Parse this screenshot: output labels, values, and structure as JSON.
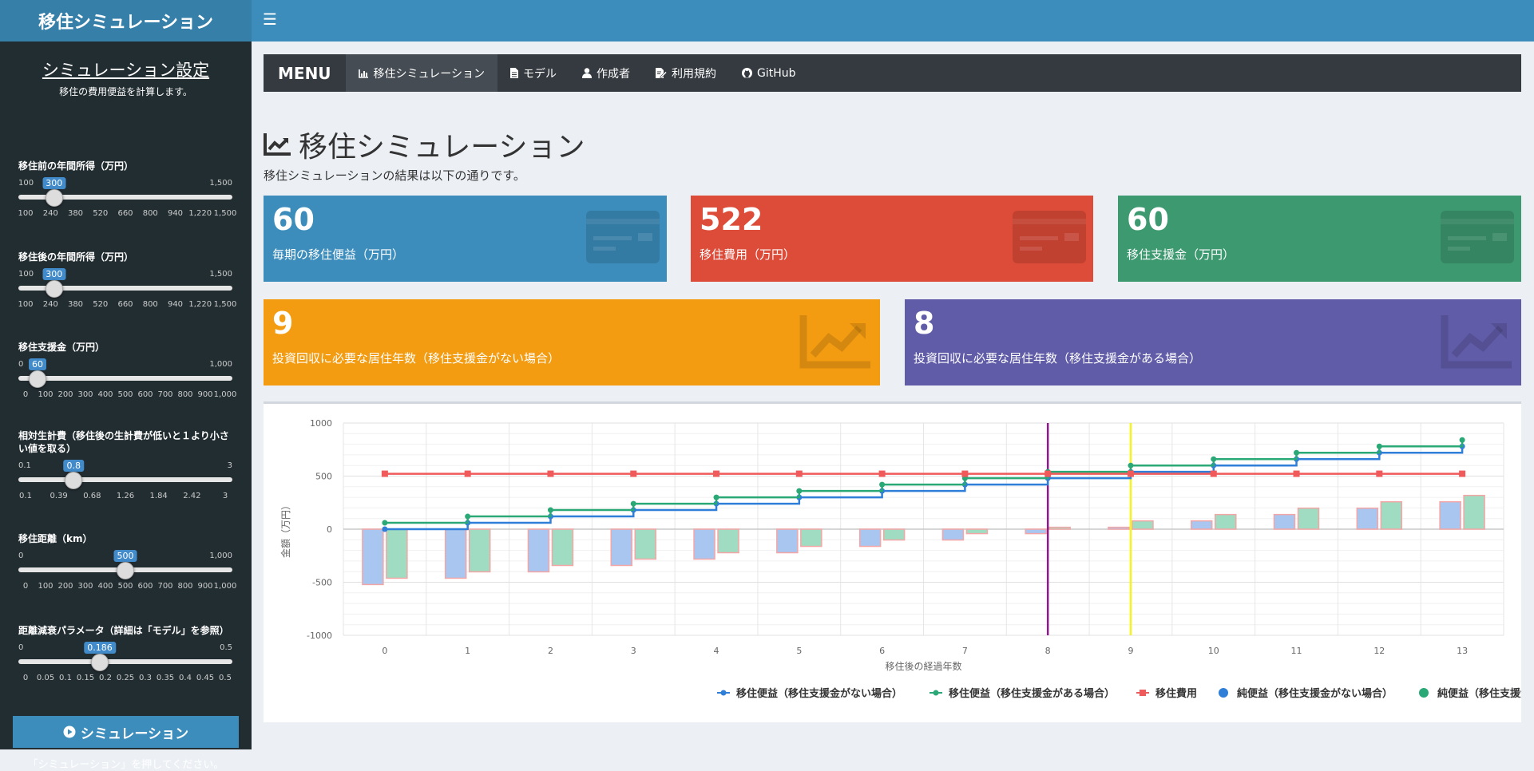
{
  "app": {
    "title": "移住シミュレーション",
    "toggle_icon": "menu-icon"
  },
  "sidebar": {
    "title": "シミュレーション設定",
    "subtitle": "移住の費用便益を計算します。",
    "sliders": [
      {
        "label": "移住前の年間所得（万円）",
        "min_label": "100",
        "max_label": "1,500",
        "value_label": "300",
        "value_fraction": 0.143,
        "ticks": [
          "100",
          "240",
          "380",
          "520",
          "660",
          "800",
          "940",
          "1,220",
          "1,500"
        ]
      },
      {
        "label": "移住後の年間所得（万円）",
        "min_label": "100",
        "max_label": "1,500",
        "value_label": "300",
        "value_fraction": 0.143,
        "ticks": [
          "100",
          "240",
          "380",
          "520",
          "660",
          "800",
          "940",
          "1,220",
          "1,500"
        ]
      },
      {
        "label": "移住支援金（万円）",
        "min_label": "0",
        "max_label": "1,000",
        "value_label": "60",
        "value_fraction": 0.06,
        "ticks": [
          "0",
          "100",
          "200",
          "300",
          "400",
          "500",
          "600",
          "700",
          "800",
          "900",
          "1,000"
        ]
      },
      {
        "label": "相対生計費（移住後の生計費が低いと１より小さい値を取る）",
        "min_label": "0.1",
        "max_label": "3",
        "value_label": "0.8",
        "value_fraction": 0.241,
        "ticks": [
          "0.1",
          "0.39",
          "0.68",
          "1.26",
          "1.84",
          "2.42",
          "3"
        ]
      },
      {
        "label": "移住距離（km）",
        "min_label": "0",
        "max_label": "1,000",
        "value_label": "500",
        "value_fraction": 0.5,
        "ticks": [
          "0",
          "100",
          "200",
          "300",
          "400",
          "500",
          "600",
          "700",
          "800",
          "900",
          "1,000"
        ]
      },
      {
        "label": "距離減衰パラメータ（詳細は「モデル」を参照）",
        "min_label": "0",
        "max_label": "0.5",
        "value_label": "0.186",
        "value_fraction": 0.372,
        "ticks": [
          "0",
          "0.05",
          "0.1",
          "0.15",
          "0.2",
          "0.25",
          "0.3",
          "0.35",
          "0.4",
          "0.45",
          "0.5"
        ]
      }
    ],
    "button_label": "シミュレーション",
    "button_icon": "play-circle-icon",
    "note": "「シミュレーション」を押してください。"
  },
  "menu": {
    "brand": "MENU",
    "items": [
      {
        "label": "移住シミュレーション",
        "icon": "bar-chart-icon",
        "active": true
      },
      {
        "label": "モデル",
        "icon": "file-icon",
        "active": false
      },
      {
        "label": "作成者",
        "icon": "user-icon",
        "active": false
      },
      {
        "label": "利用規約",
        "icon": "edit-document-icon",
        "active": false
      },
      {
        "label": "GitHub",
        "icon": "github-icon",
        "active": false
      }
    ]
  },
  "page": {
    "title": "移住シミュレーション",
    "title_icon": "line-chart-icon",
    "subtitle": "移住シミュレーションの結果は以下の通りです。"
  },
  "value_boxes": [
    {
      "value": "60",
      "label": "毎期の移住便益（万円）",
      "color": "#3c8dbc",
      "icon": "credit-card-icon"
    },
    {
      "value": "522",
      "label": "移住費用（万円）",
      "color": "#dd4b39",
      "icon": "credit-card-icon"
    },
    {
      "value": "60",
      "label": "移住支援金（万円）",
      "color": "#3d9970",
      "icon": "credit-card-icon"
    },
    {
      "value": "9",
      "label": "投資回収に必要な居住年数（移住支援金がない場合）",
      "color": "#f39c12",
      "icon": "chart-line-icon"
    },
    {
      "value": "8",
      "label": "投資回収に必要な居住年数（移住支援金がある場合）",
      "color": "#605ca8",
      "icon": "chart-line-icon"
    }
  ],
  "chart_data": {
    "type": "line",
    "xlabel": "移住後の経過年数",
    "ylabel": "金額（万円）",
    "x": [
      0,
      1,
      2,
      3,
      4,
      5,
      6,
      7,
      8,
      9,
      10,
      11,
      12,
      13
    ],
    "ylim": [
      -1000,
      1000
    ],
    "yticks": [
      "1000",
      "500",
      "0",
      "-500",
      "-1000"
    ],
    "grid": true,
    "legend_position": "bottom",
    "series": [
      {
        "name": "移住便益（移住支援金がない場合）",
        "type": "step-line",
        "color": "#2f7ed8",
        "values": [
          0,
          60,
          120,
          180,
          240,
          300,
          360,
          420,
          480,
          540,
          600,
          660,
          720,
          780
        ]
      },
      {
        "name": "移住便益（移住支援金がある場合）",
        "type": "step-line",
        "color": "#2aa876",
        "values": [
          60,
          120,
          180,
          240,
          300,
          360,
          420,
          480,
          540,
          600,
          660,
          720,
          780,
          840
        ]
      },
      {
        "name": "移住費用",
        "type": "line",
        "color": "#f05a5a",
        "values": [
          522,
          522,
          522,
          522,
          522,
          522,
          522,
          522,
          522,
          522,
          522,
          522,
          522,
          522
        ]
      },
      {
        "name": "純便益（移住支援金がない場合）",
        "type": "bar",
        "color": "#a8c6ef",
        "values": [
          -522,
          -462,
          -402,
          -342,
          -282,
          -222,
          -162,
          -102,
          -42,
          18,
          78,
          138,
          198,
          258
        ]
      },
      {
        "name": "純便益（移住支援金がある場合）",
        "type": "bar",
        "color": "#9fdcc1",
        "values": [
          -462,
          -402,
          -342,
          -282,
          -222,
          -162,
          -102,
          -42,
          18,
          78,
          138,
          198,
          258,
          318
        ]
      }
    ],
    "vlines": [
      {
        "x": 8,
        "color": "#8e1a8e"
      },
      {
        "x": 9,
        "color": "#f5f51a"
      }
    ]
  }
}
